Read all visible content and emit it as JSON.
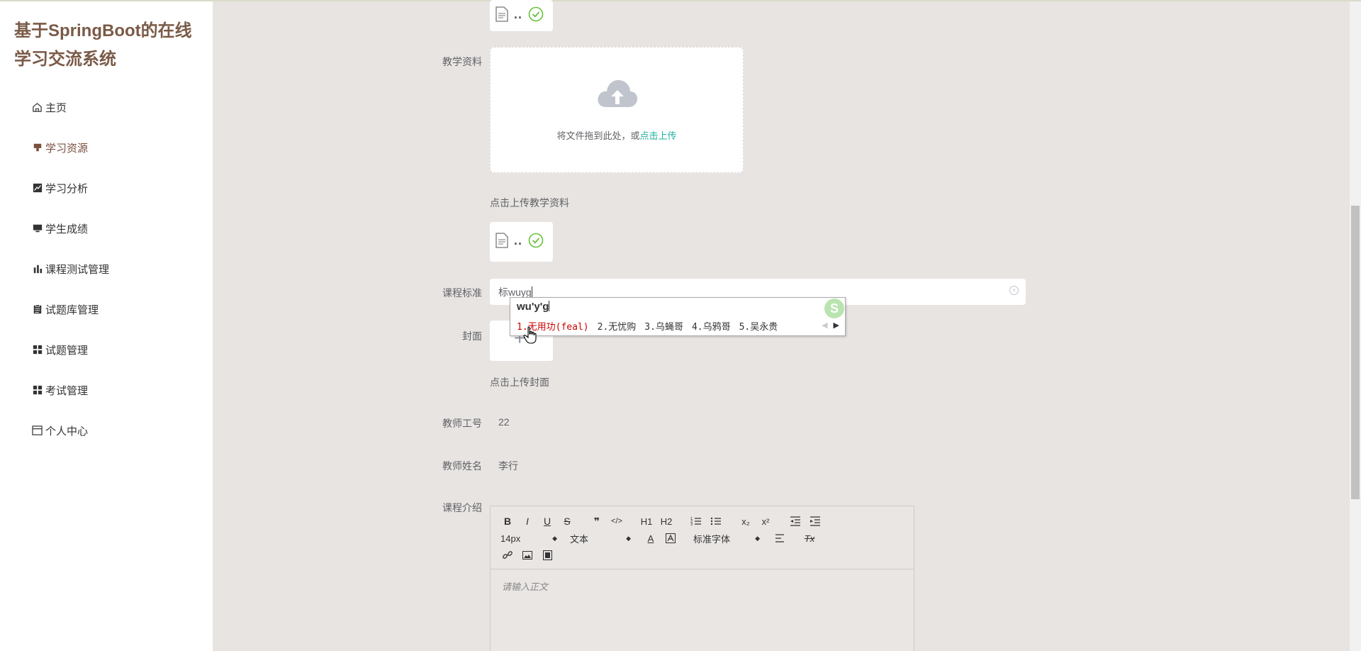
{
  "app": {
    "title": "基于SpringBoot的在线学习交流系统"
  },
  "sidebar": {
    "items": [
      {
        "label": "主页",
        "icon": "home-icon"
      },
      {
        "label": "学习资源",
        "icon": "resource-icon"
      },
      {
        "label": "学习分析",
        "icon": "chart-line-icon"
      },
      {
        "label": "学生成绩",
        "icon": "monitor-icon"
      },
      {
        "label": "课程测试管理",
        "icon": "bar-chart-icon"
      },
      {
        "label": "试题库管理",
        "icon": "clipboard-icon"
      },
      {
        "label": "试题管理",
        "icon": "grid-icon"
      },
      {
        "label": "考试管理",
        "icon": "grid-icon"
      },
      {
        "label": "个人中心",
        "icon": "window-icon"
      }
    ]
  },
  "form": {
    "top_file": {
      "dots": ".."
    },
    "material": {
      "label": "教学资料",
      "upload_text": "将文件拖到此处，或",
      "upload_link": "点击上传",
      "hint": "点击上传教学资料",
      "file_dots": ".."
    },
    "standard": {
      "label": "课程标准",
      "value": "标wuyg"
    },
    "cover": {
      "label": "封面",
      "plus": "+",
      "hint": "点击上传封面"
    },
    "teacher_id": {
      "label": "教师工号",
      "value": "22"
    },
    "teacher_name": {
      "label": "教师姓名",
      "value": "李行"
    },
    "intro": {
      "label": "课程介绍",
      "font_size": "14px",
      "heading": "文本",
      "font_family": "标准字体",
      "placeholder": "请输入正文"
    }
  },
  "ime": {
    "pinyin": "wu'y'g",
    "candidates": [
      "1.无用功(feal)",
      "2.无忧购",
      "3.乌蝇哥",
      "4.乌鸦哥",
      "5.吴永贵"
    ],
    "logo": "S"
  },
  "toolbar_buttons": {
    "bold": "B",
    "italic": "I",
    "underline": "U",
    "strike": "S",
    "quote": "❞",
    "code": "</>",
    "h1": "H1",
    "h2": "H2",
    "sub": "x₂",
    "sup": "x²",
    "color": "A",
    "clean": "Tx"
  }
}
